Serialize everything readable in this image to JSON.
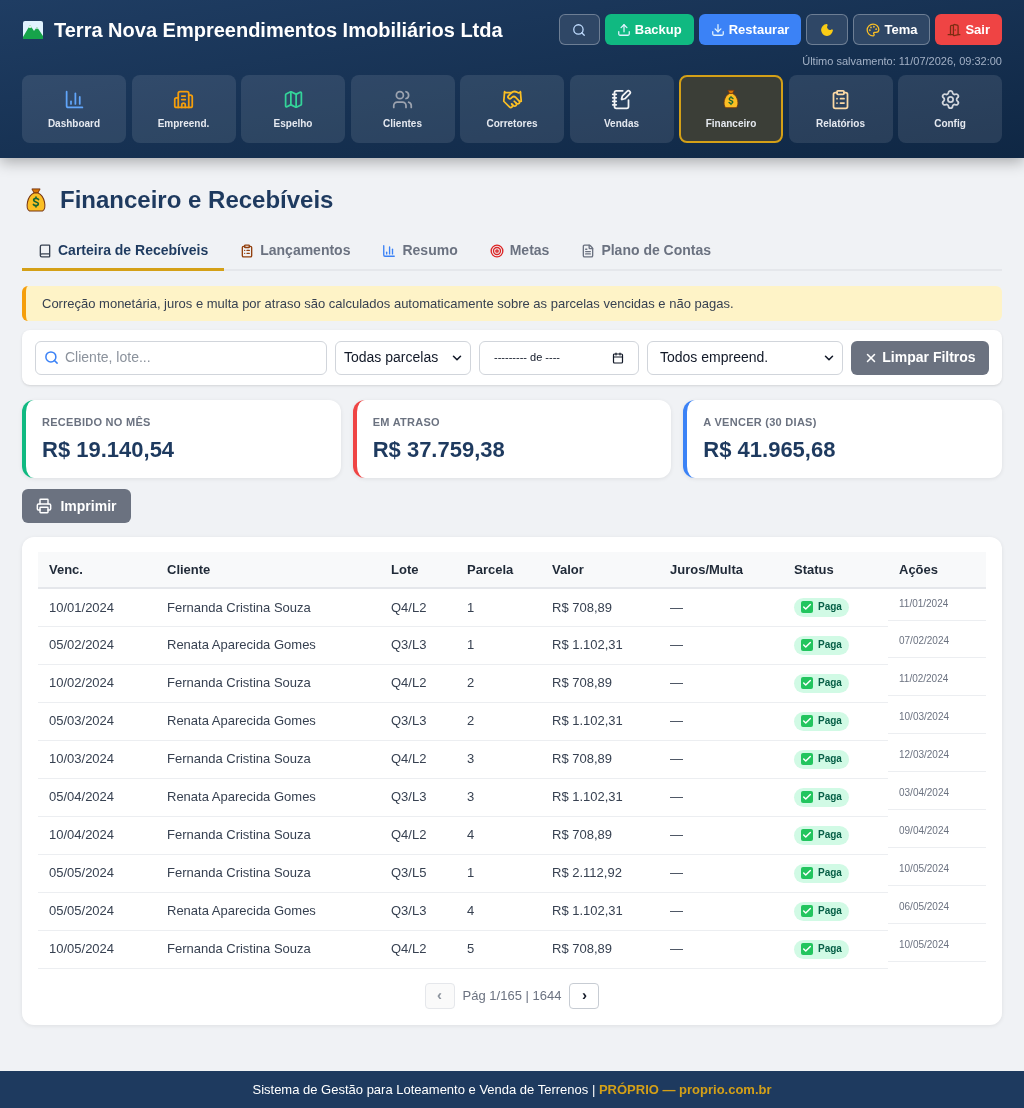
{
  "header": {
    "title": "Terra Nova Empreendimentos Imobiliários Ltda",
    "actions": [
      {
        "kind": "search"
      },
      {
        "kind": "backup",
        "label": "Backup"
      },
      {
        "kind": "restore",
        "label": "Restaurar"
      },
      {
        "kind": "darkmode"
      },
      {
        "kind": "theme",
        "label": "Tema"
      },
      {
        "kind": "logout",
        "label": "Sair"
      }
    ],
    "last_saved": "Último salvamento: 11/07/2026, 09:32:00"
  },
  "nav": [
    {
      "label": "Dashboard",
      "selected": false
    },
    {
      "label": "Empreend.",
      "selected": false
    },
    {
      "label": "Espelho",
      "selected": false
    },
    {
      "label": "Clientes",
      "selected": false
    },
    {
      "label": "Corretores",
      "selected": false
    },
    {
      "label": "Vendas",
      "selected": false
    },
    {
      "label": "Financeiro",
      "selected": true
    },
    {
      "label": "Relatórios",
      "selected": false
    },
    {
      "label": "Config",
      "selected": false
    }
  ],
  "page": {
    "title": "Financeiro e Recebíveis"
  },
  "tabs": [
    {
      "label": "Carteira de Recebíveis",
      "selected": true
    },
    {
      "label": "Lançamentos",
      "selected": false
    },
    {
      "label": "Resumo",
      "selected": false
    },
    {
      "label": "Metas",
      "selected": false
    },
    {
      "label": "Plano de Contas",
      "selected": false
    }
  ],
  "alert": {
    "text": "Correção monetária, juros e multa por atraso são calculados automaticamente sobre as parcelas vencidas e não pagas."
  },
  "filters": {
    "search": {
      "placeholder": "Cliente, lote..."
    },
    "installment_select": {
      "value": "Todas parcelas"
    },
    "month": {
      "value": "--------- de ----"
    },
    "development_select": {
      "value": "Todos empreend."
    },
    "clear_button": {
      "label": "Limpar Filtros"
    }
  },
  "summary": [
    {
      "label": "RECEBIDO NO MÊS",
      "value": "R$ 19.140,54",
      "color": "#10b981"
    },
    {
      "label": "EM ATRASO",
      "value": "R$ 37.759,38",
      "color": "#ef4444"
    },
    {
      "label": "A VENCER (30 DIAS)",
      "value": "R$ 41.965,68",
      "color": "#3b82f6"
    }
  ],
  "print_button": {
    "label": "Imprimir"
  },
  "table": {
    "columns": [
      "Venc.",
      "Cliente",
      "Lote",
      "Parcela",
      "Valor",
      "Juros/Multa",
      "Status",
      "Ações"
    ],
    "rows": [
      {
        "venc": "10/01/2024",
        "cliente": "Fernanda Cristina Souza",
        "lote": "Q4/L2",
        "parcela": "1",
        "valor": "R$ 708,89",
        "juros_multa": "—",
        "status": {
          "label": "Paga",
          "kind": "paid"
        },
        "acoes": "11/01/2024"
      },
      {
        "venc": "05/02/2024",
        "cliente": "Renata Aparecida Gomes",
        "lote": "Q3/L3",
        "parcela": "1",
        "valor": "R$ 1.102,31",
        "juros_multa": "—",
        "status": {
          "label": "Paga",
          "kind": "paid"
        },
        "acoes": "07/02/2024"
      },
      {
        "venc": "10/02/2024",
        "cliente": "Fernanda Cristina Souza",
        "lote": "Q4/L2",
        "parcela": "2",
        "valor": "R$ 708,89",
        "juros_multa": "—",
        "status": {
          "label": "Paga",
          "kind": "paid"
        },
        "acoes": "11/02/2024"
      },
      {
        "venc": "05/03/2024",
        "cliente": "Renata Aparecida Gomes",
        "lote": "Q3/L3",
        "parcela": "2",
        "valor": "R$ 1.102,31",
        "juros_multa": "—",
        "status": {
          "label": "Paga",
          "kind": "paid"
        },
        "acoes": "10/03/2024"
      },
      {
        "venc": "10/03/2024",
        "cliente": "Fernanda Cristina Souza",
        "lote": "Q4/L2",
        "parcela": "3",
        "valor": "R$ 708,89",
        "juros_multa": "—",
        "status": {
          "label": "Paga",
          "kind": "paid"
        },
        "acoes": "12/03/2024"
      },
      {
        "venc": "05/04/2024",
        "cliente": "Renata Aparecida Gomes",
        "lote": "Q3/L3",
        "parcela": "3",
        "valor": "R$ 1.102,31",
        "juros_multa": "—",
        "status": {
          "label": "Paga",
          "kind": "paid"
        },
        "acoes": "03/04/2024"
      },
      {
        "venc": "10/04/2024",
        "cliente": "Fernanda Cristina Souza",
        "lote": "Q4/L2",
        "parcela": "4",
        "valor": "R$ 708,89",
        "juros_multa": "—",
        "status": {
          "label": "Paga",
          "kind": "paid"
        },
        "acoes": "09/04/2024"
      },
      {
        "venc": "05/05/2024",
        "cliente": "Fernanda Cristina Souza",
        "lote": "Q3/L5",
        "parcela": "1",
        "valor": "R$ 2.112,92",
        "juros_multa": "—",
        "status": {
          "label": "Paga",
          "kind": "paid"
        },
        "acoes": "10/05/2024"
      },
      {
        "venc": "05/05/2024",
        "cliente": "Renata Aparecida Gomes",
        "lote": "Q3/L3",
        "parcela": "4",
        "valor": "R$ 1.102,31",
        "juros_multa": "—",
        "status": {
          "label": "Paga",
          "kind": "paid"
        },
        "acoes": "06/05/2024"
      },
      {
        "venc": "10/05/2024",
        "cliente": "Fernanda Cristina Souza",
        "lote": "Q4/L2",
        "parcela": "5",
        "valor": "R$ 708,89",
        "juros_multa": "—",
        "status": {
          "label": "Paga",
          "kind": "paid"
        },
        "acoes": "10/05/2024"
      }
    ]
  },
  "pagination": {
    "prev": {
      "label": "‹",
      "disabled": true
    },
    "info": "Pág 1/165 | 1644",
    "next": {
      "label": "›",
      "disabled": false
    }
  },
  "footer": {
    "text": "Sistema de Gestão para Loteamento e Venda de Terrenos |",
    "brand": "PRÓPRIO — proprio.com.br"
  }
}
